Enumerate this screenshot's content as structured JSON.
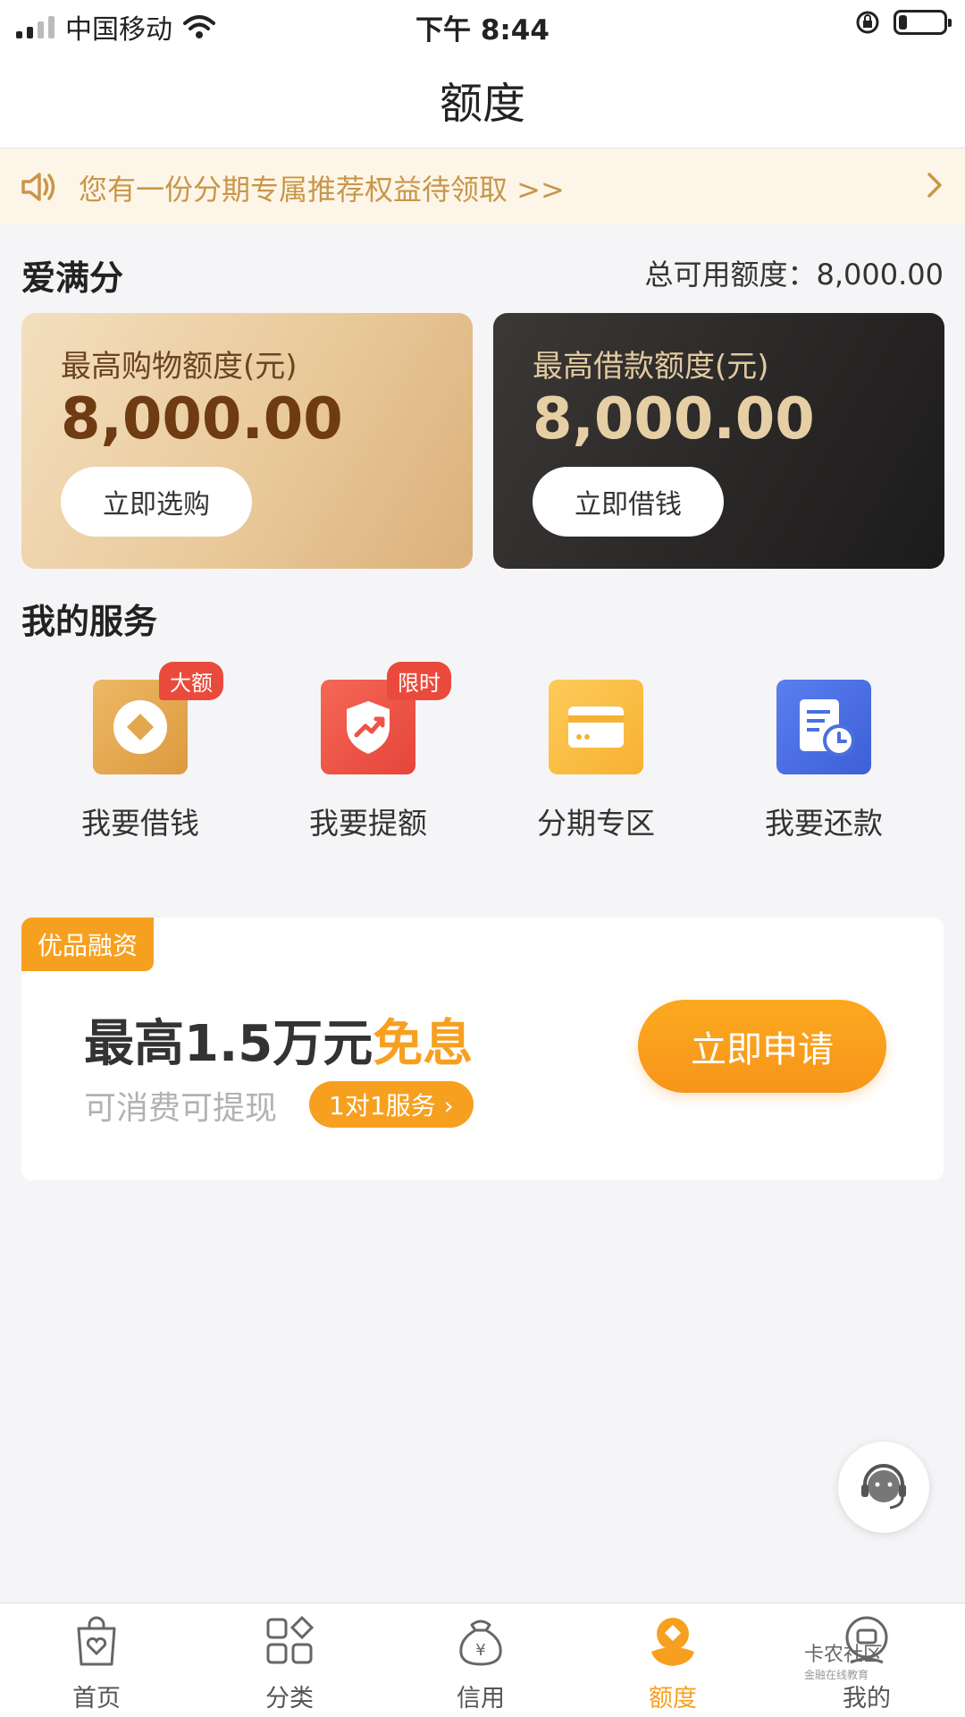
{
  "status_bar": {
    "carrier": "中国移动",
    "time": "下午 8:44"
  },
  "header": {
    "title": "额度"
  },
  "notice": {
    "text": "您有一份分期专属推荐权益待领取 >>"
  },
  "credit": {
    "brand": "爱满分",
    "total_label": "总可用额度：8,000.00",
    "shopping": {
      "label": "最高购物额度(元)",
      "amount": "8,000.00",
      "button": "立即选购"
    },
    "loan": {
      "label": "最高借款额度(元)",
      "amount": "8,000.00",
      "button": "立即借钱"
    }
  },
  "services": {
    "title": "我的服务",
    "items": [
      {
        "label": "我要借钱",
        "badge": "大额",
        "icon": "coin-icon",
        "color": "#e3a74e"
      },
      {
        "label": "我要提额",
        "badge": "限时",
        "icon": "shield-up-icon",
        "color": "#ee5446"
      },
      {
        "label": "分期专区",
        "badge": "",
        "icon": "card-icon",
        "color": "#fbbd45"
      },
      {
        "label": "我要还款",
        "badge": "",
        "icon": "bill-clock-icon",
        "color": "#4a6fe0"
      }
    ]
  },
  "promo": {
    "tag": "优品融资",
    "headline_main": "最高1.5万元",
    "headline_highlight": "免息",
    "subtitle": "可消费可提现",
    "pill": "1对1服务 ›",
    "button": "立即申请"
  },
  "tabbar": {
    "items": [
      {
        "label": "首页",
        "icon": "bag-heart-icon",
        "active": false
      },
      {
        "label": "分类",
        "icon": "grid-icon",
        "active": false
      },
      {
        "label": "信用",
        "icon": "money-bag-icon",
        "active": false
      },
      {
        "label": "额度",
        "icon": "flower-icon",
        "active": true
      },
      {
        "label": "我的",
        "icon": "profile-icon",
        "active": false
      }
    ]
  },
  "watermark": {
    "title": "卡农社区",
    "subtitle": "金融在线教育"
  },
  "colors": {
    "accent": "#f7a020",
    "gold_text": "#c9964a",
    "dark_card": "#2a2827"
  }
}
